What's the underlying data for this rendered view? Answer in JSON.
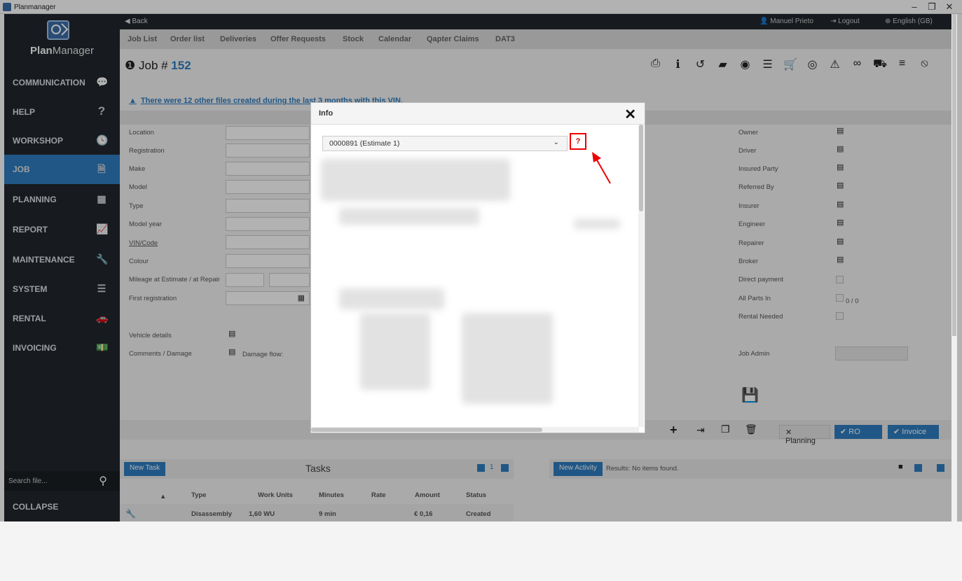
{
  "window": {
    "title": "Planmanager",
    "controls": [
      "–",
      "❐",
      "✕"
    ]
  },
  "sidebar": {
    "brand_bold": "Plan",
    "brand_rest": "Manager",
    "items": [
      {
        "label": "COMMUNICATION",
        "icon": "chat-icon",
        "glyph": "💬"
      },
      {
        "label": "HELP",
        "icon": "question-icon",
        "glyph": "?"
      },
      {
        "label": "WORKSHOP",
        "icon": "clock-icon",
        "glyph": "🕓"
      },
      {
        "label": "JOB",
        "icon": "file-icon",
        "glyph": "🗎",
        "active": true
      },
      {
        "label": "PLANNING",
        "icon": "calendar-icon",
        "glyph": "▦"
      },
      {
        "label": "REPORT",
        "icon": "chart-icon",
        "glyph": "📈"
      },
      {
        "label": "MAINTENANCE",
        "icon": "wrench-icon",
        "glyph": "🔧"
      },
      {
        "label": "SYSTEM",
        "icon": "sliders-icon",
        "glyph": "☰"
      },
      {
        "label": "RENTAL",
        "icon": "car-icon",
        "glyph": "🚗"
      },
      {
        "label": "INVOICING",
        "icon": "money-icon",
        "glyph": "💵"
      }
    ],
    "search_placeholder": "Search file...",
    "collapse_label": "COLLAPSE"
  },
  "topbar": {
    "back": "◀ Back",
    "user": "Manuel Prieto",
    "logout": "Logout",
    "language": "English (GB)"
  },
  "tabs": [
    "Job List",
    "Order list",
    "Deliveries",
    "Offer Requests",
    "Stock",
    "Calendar",
    "Qapter Claims",
    "DAT3"
  ],
  "job": {
    "prefix": "Job # ",
    "number": "152"
  },
  "warning": "There were 12 other files created during the last 3 months with this VIN.",
  "form_left": [
    "Location",
    "Registration",
    "Make",
    "Model",
    "Type",
    "Model year",
    "VIN/Code",
    "Colour",
    "Mileage at Estimate / at Repair",
    "First registration"
  ],
  "vehicle_details": "Vehicle details",
  "comments_damage": "Comments / Damage",
  "damage_flow": "Damage flow:",
  "form_right": [
    "Owner",
    "Driver",
    "Insured Party",
    "Referred By",
    "Insurer",
    "Engineer",
    "Repairer",
    "Broker",
    "Direct payment",
    "All Parts In",
    "Rental Needed"
  ],
  "all_parts_count": "0 / 0",
  "job_admin": "Job Admin",
  "actions": {
    "planning": "✕ Planning",
    "ro": "✔ RO",
    "invoice": "✔ Invoice"
  },
  "tasks": {
    "new_task": "New Task",
    "title": "Tasks",
    "page": "1",
    "columns": [
      "Type",
      "Work Units",
      "Minutes",
      "Rate",
      "Amount",
      "Status"
    ],
    "rows": [
      [
        "Disassembly",
        "1,60 WU",
        "9 min",
        "",
        "€ 0,16",
        "Created"
      ]
    ]
  },
  "activity": {
    "new_activity": "New Activity",
    "results": "Results: No items found."
  },
  "modal": {
    "title": "Info",
    "close": "✕",
    "select_value": "0000891 (Estimate 1)",
    "help": "?"
  }
}
